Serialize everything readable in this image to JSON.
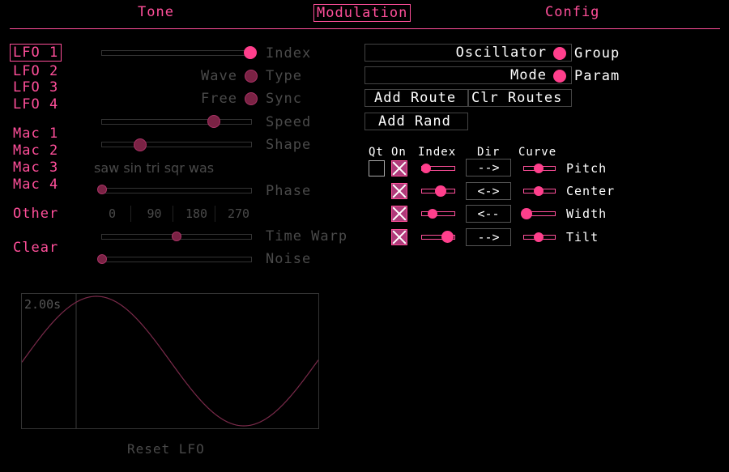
{
  "tabs": {
    "tone": "Tone",
    "modulation": "Modulation",
    "config": "Config"
  },
  "sidebar": {
    "lfo": [
      "LFO 1",
      "LFO 2",
      "LFO 3",
      "LFO 4"
    ],
    "mac": [
      "Mac 1",
      "Mac 2",
      "Mac 3",
      "Mac 4"
    ],
    "other": "Other",
    "clear": "Clear"
  },
  "lfo_params": {
    "index_label": "Index",
    "wave_value": "Wave",
    "type_label": "Type",
    "sync_value": "Free",
    "sync_label": "Sync",
    "speed_label": "Speed",
    "shape_label": "Shape",
    "shape_presets": "saw sin tri sqr was",
    "phase_label": "Phase",
    "phase_values": [
      "0",
      "90",
      "180",
      "270"
    ],
    "time_warp_label": "Time Warp",
    "noise_label": "Noise"
  },
  "wave_display": {
    "duration": "2.00s",
    "reset_label": "Reset LFO"
  },
  "routing": {
    "group_value": "Oscillator",
    "group_label": "Group",
    "param_value": "Mode",
    "param_label": "Param",
    "add_route": "Add Route",
    "clr_routes": "Clr Routes",
    "add_rand": "Add Rand",
    "headers": {
      "qt": "Qt",
      "on": "On",
      "index": "Index",
      "dir": "Dir",
      "curve": "Curve"
    },
    "rows": [
      {
        "dir": "-->",
        "target": "Pitch"
      },
      {
        "dir": "<->",
        "target": "Center"
      },
      {
        "dir": "<--",
        "target": "Width"
      },
      {
        "dir": "-->",
        "target": "Tilt"
      }
    ]
  },
  "colors": {
    "accent": "#ff4f9a",
    "dim": "#4a4a4a",
    "background": "#000000"
  }
}
